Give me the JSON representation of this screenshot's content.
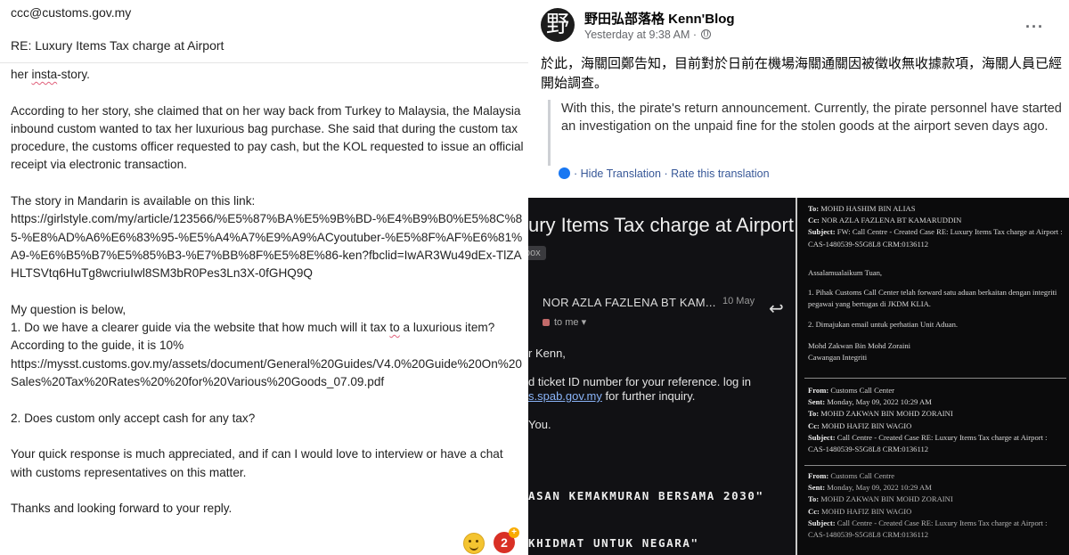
{
  "email": {
    "to": "ccc@customs.gov.my",
    "subject": "RE: Luxury Items Tax charge at Airport",
    "line_intro_pre": "her ",
    "line_intro_squig": "insta",
    "line_intro_post": "-story.",
    "para1": "According to her story, she claimed that on her way back from Turkey to Malaysia, the Malaysia inbound custom wanted to tax her luxurious bag purchase. She said that during the custom tax procedure, the customs officer requested to pay cash, but the KOL requested to issue an official receipt via electronic transaction.",
    "para2_label": "The story in Mandarin is available on this link:",
    "para2_url": "https://girlstyle.com/my/article/123566/%E5%87%BA%E5%9B%BD-%E4%B9%B0%E5%8C%85-%E8%AD%A6%E6%83%95-%E5%A4%A7%E9%A9%ACyoutuber-%E5%8F%AF%E6%81%A9-%E6%B5%B7%E5%85%B3-%E7%BB%8F%E5%8E%86-ken?fbclid=IwAR3Wu49dEx-TlZAHLTSVtq6HuTg8wcriuIwl8SM3bR0Pes3Ln3X-0fGHQ9Q",
    "q_intro": "My question is below,",
    "q1_pre": "1. Do we have a clearer guide via the website that how much will it tax ",
    "q1_squig": "to",
    "q1_post": " a luxurious item?",
    "q1_guide": "According to the guide, it is 10%",
    "q1_url": "https://mysst.customs.gov.my/assets/document/General%20Guides/V4.0%20Guide%20On%20Sales%20Tax%20Rates%20%20for%20Various%20Goods_07.09.pdf",
    "q2": "2. Does custom only accept cash for any tax?",
    "closing1_pre": "Your quick response is much appreciated, and if can I would love to interview or have a chat with customs representatives on this matter.",
    "closing2": "Thanks and looking forward to your reply.",
    "reaction_count": "2",
    "reaction_plus": "+"
  },
  "fb_post": {
    "avatar_glyph": "野",
    "author": "野田弘部落格 Kenn'Blog",
    "meta": "Yesterday at 9:38 AM · ",
    "more": "···",
    "text_zh": "於此，海關回鄭告知，目前對於日前在機場海關通關因被徵收無收據款項，海關人員已經開始調查。",
    "translation": "With this, the pirate's return announcement. Currently, the pirate personnel have started an investigation on the unpaid fine for the stolen goods at the airport seven days ago.",
    "hide_translation": "· Hide Translation",
    "rate_translation": " · Rate this translation"
  },
  "dark_email": {
    "title": "ury Items Tax charge at Airport",
    "inbox_chip": "box",
    "sender": "NOR AZLA FAZLENA BT KAM...",
    "date": "10 May",
    "reply_icon": "↩",
    "to_me": "to me ▾",
    "line1": "r Kenn,",
    "line2": "d ticket ID number for your reference. log in",
    "line3_link": "s.spab.gov.my",
    "line3_rest": " for further inquiry.",
    "line4": "You.",
    "mono1": "ASAN KEMAKMURAN BERSAMA 2030\"",
    "mono2": "KHIDMAT UNTUK NEGARA\""
  },
  "printed_email": {
    "to_label": "To:",
    "to_value": "MOHD HASHIM BIN ALIAS",
    "cc_label": "Cc:",
    "cc_value": "NOR AZLA FAZLENA BT KAMARUDDIN",
    "subject_label": "Subject:",
    "subject_value": "FW: Call Centre - Created Case RE: Luxury Items Tax charge at Airport : CAS-1480539-S5G8L8 CRM:0136112",
    "greeting": "Assalamualaikum Tuan,",
    "item1": "1. Pihak Customs Call Center telah forward satu aduan berkaitan dengan integriti pegawai yang bertugas di JKDM KLIA.",
    "item2": "2. Dimajukan email untuk perhatian Unit Aduan.",
    "sig_name": "Mohd Zakwan Bin Mohd Zoraini",
    "sig_unit": "Cawangan Integriti",
    "f_from_label": "From:",
    "f_from_value": "Customs Call Center",
    "f_sent_label": "Sent:",
    "f_sent_value": "Monday, May 09, 2022 10:29 AM",
    "f_to_label": "To:",
    "f_to_value": "MOHD ZAKWAN BIN MOHD ZORAINI",
    "f_cc_label": "Cc:",
    "f_cc_value": "MOHD HAFIZ BIN WAGIO",
    "f_subject_label": "Subject:",
    "f_subject_value": "Call Centre - Created Case RE: Luxury Items Tax charge at Airport : CAS-1480539-S5G8L8 CRM:0136112",
    "g_from_label": "From:",
    "g_from_value": "Customs Call Centre",
    "g_sent_label": "Sent:",
    "g_sent_value": "Monday, May 09, 2022 10:29 AM",
    "g_to_label": "To:",
    "g_to_value": "MOHD ZAKWAN BIN MOHD ZORAINI",
    "g_cc_label": "Cc:",
    "g_cc_value": "MOHD HAFIZ BIN WAGIO",
    "g_subject_label": "Subject:",
    "g_subject_value": "Call Centre - Created Case RE: Luxury Items Tax charge at Airport : CAS-1480539-S5G8L8 CRM:0136112"
  }
}
